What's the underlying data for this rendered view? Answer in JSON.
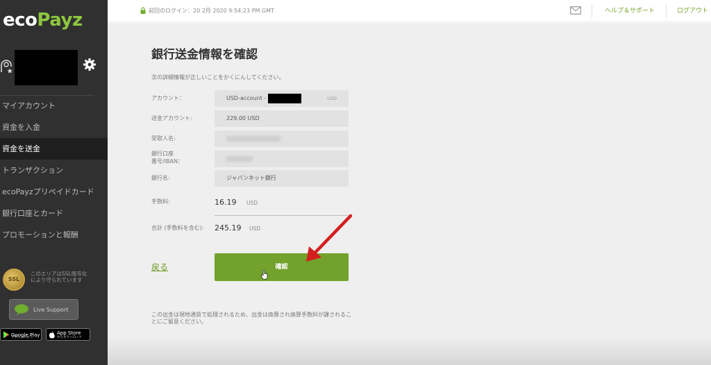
{
  "brand": {
    "logo_eco": "eco",
    "logo_payz": "Payz"
  },
  "sidebar": {
    "items": [
      {
        "label": "マイアカウント",
        "active": false
      },
      {
        "label": "資金を入金",
        "active": false
      },
      {
        "label": "資金を送金",
        "active": true
      },
      {
        "label": "トランザクション",
        "active": false
      },
      {
        "label": "ecoPayzプリペイドカード",
        "active": false
      },
      {
        "label": "銀行口座とカード",
        "active": false
      },
      {
        "label": "プロモーションと報酬",
        "active": false
      }
    ],
    "ssl_badge": "SSL",
    "ssl_text": "このエリアはSSL暗号化により守られています",
    "live_support": "Live Support",
    "google_play": {
      "title": "Google Play",
      "sub": "で手に入れよう"
    },
    "app_store": {
      "title": "App Store",
      "sub": "からダウンロード"
    }
  },
  "topbar": {
    "last_login": "前回のログイン：20 2月 2020 9:54:23 PM GMT",
    "help": "ヘルプ＆サポート",
    "logout": "ログアウト"
  },
  "main": {
    "title": "銀行送金情報を確認",
    "intro": "次の詳細情報が正しいことをかくにんしてください。",
    "account_label": "アカウント：",
    "account_value": "USD-account -",
    "account_currency": "USD",
    "transfer_label": "送金アカウント:",
    "transfer_value": "229.00 USD",
    "recipient_label": "受取人名:",
    "iban_label_1": "銀行口座",
    "iban_label_2": "番号/IBAN：",
    "bank_label": "銀行名:",
    "bank_value": "ジャパンネット銀行",
    "fee_label": "手数料:",
    "fee_value": "16.19",
    "fee_currency": "USD",
    "total_label": "合計 (手数料を含む):",
    "total_value": "245.19",
    "total_currency": "USD",
    "back": "戻る",
    "confirm": "確認",
    "note": "この出金は現地通貨で処理されるため、出金は換算され換算手数料が課されることにご留意ください。"
  },
  "colors": {
    "accent": "#72a22b",
    "sidebar": "#303030",
    "annotation_arrow": "#d41f1f"
  }
}
